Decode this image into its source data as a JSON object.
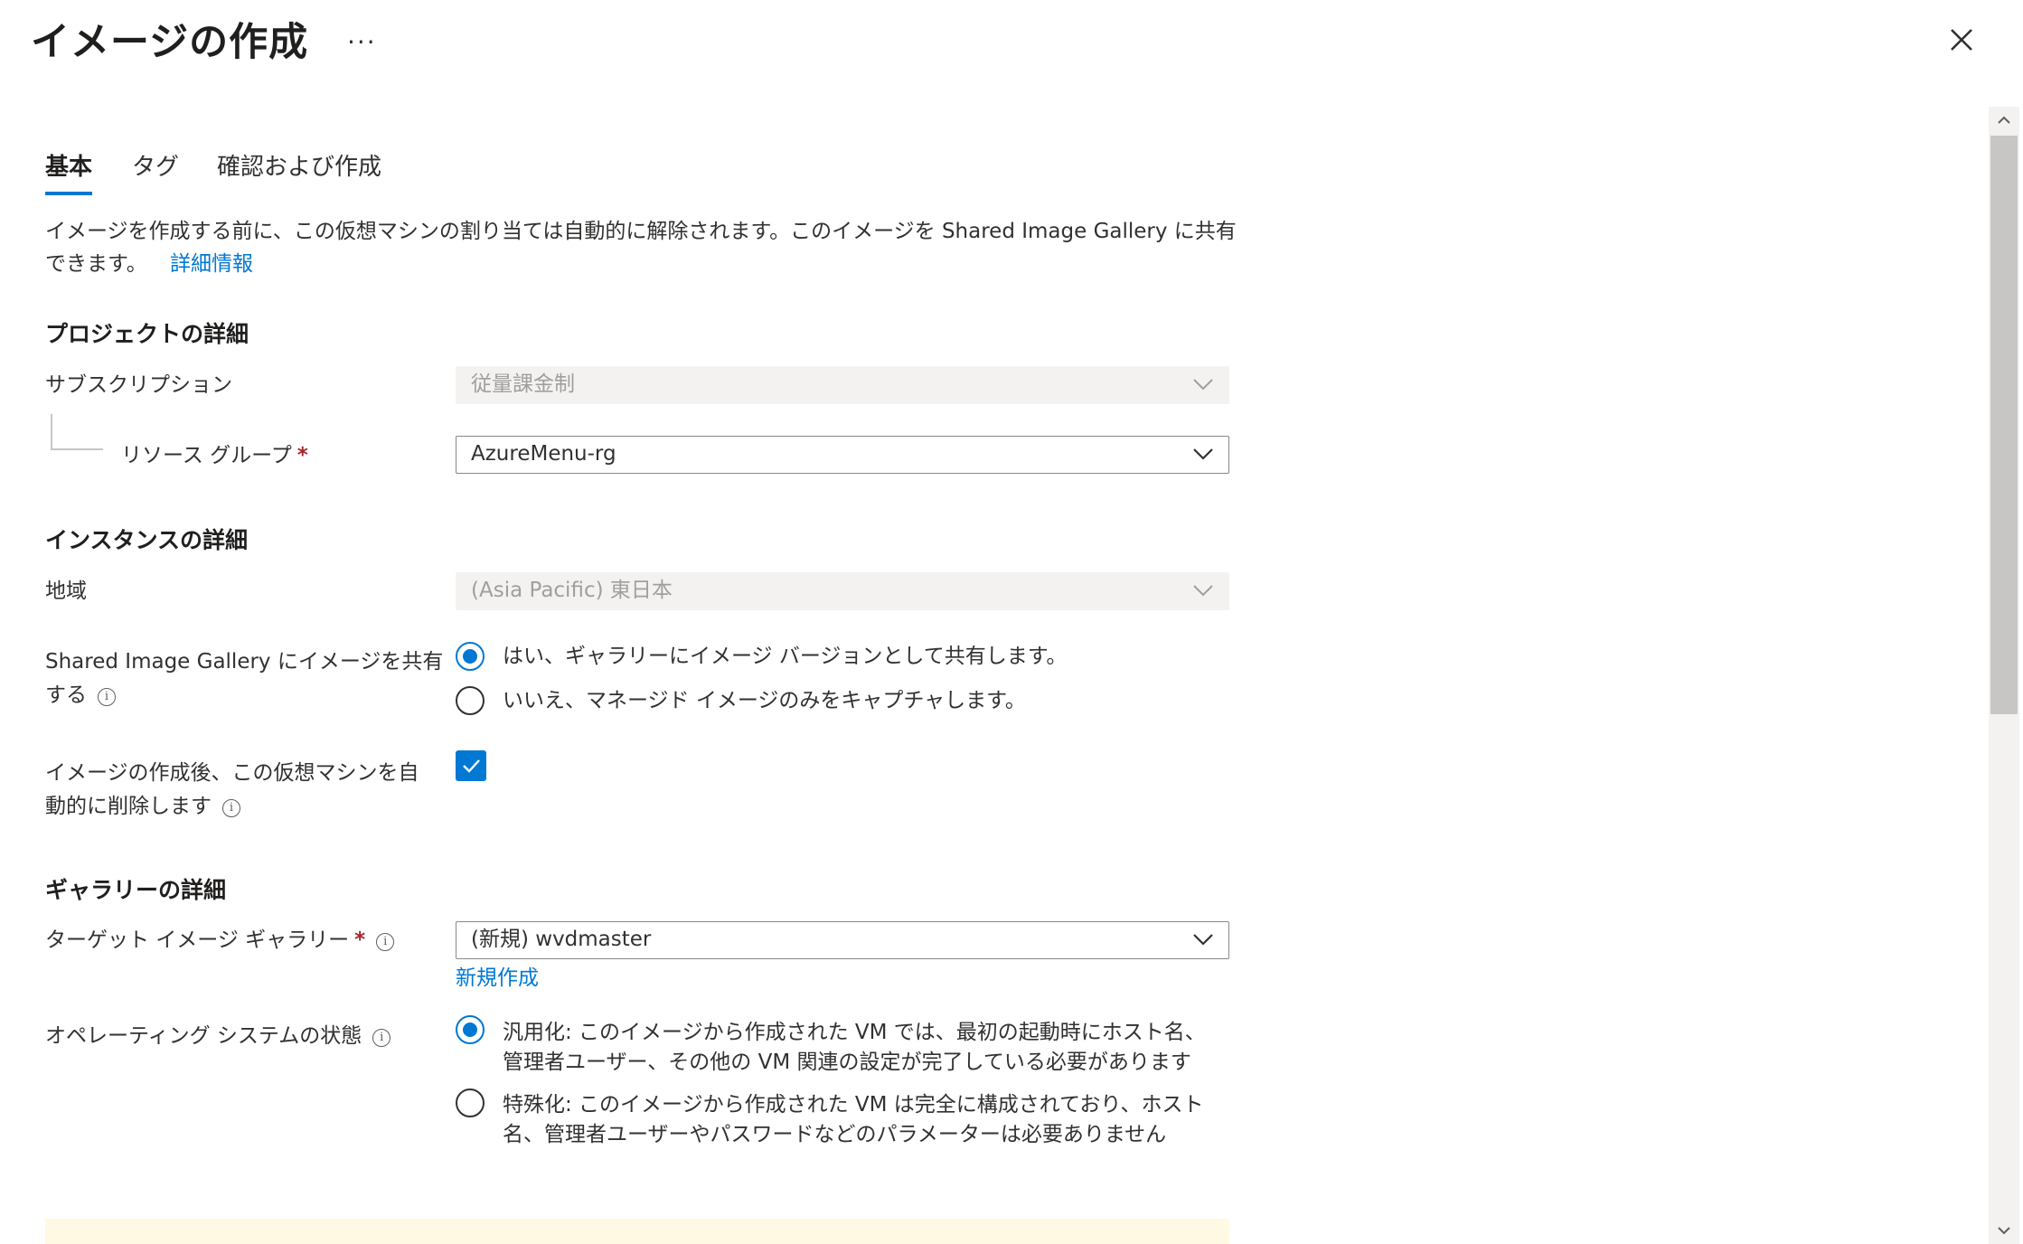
{
  "header": {
    "title": "イメージの作成",
    "more_label": "...",
    "close_icon": "close-icon"
  },
  "tabs": [
    {
      "label": "基本",
      "active": true
    },
    {
      "label": "タグ",
      "active": false
    },
    {
      "label": "確認および作成",
      "active": false
    }
  ],
  "description": {
    "text": "イメージを作成する前に、この仮想マシンの割り当ては自動的に解除されます。このイメージを Shared Image Gallery に共有できます。",
    "link": "詳細情報"
  },
  "project": {
    "heading": "プロジェクトの詳細",
    "subscription_label": "サブスクリプション",
    "subscription_value": "従量課金制",
    "resource_group_label": "リソース グループ",
    "resource_group_value": "AzureMenu-rg",
    "required_mark": "*"
  },
  "instance": {
    "heading": "インスタンスの詳細",
    "region_label": "地域",
    "region_value": "(Asia Pacific) 東日本",
    "share_label_line1": "Shared Image Gallery にイメージを共有",
    "share_label_line2": "する",
    "share_yes": "はい、ギャラリーにイメージ バージョンとして共有します。",
    "share_no": "いいえ、マネージド イメージのみをキャプチャします。",
    "autodelete_label_line1": "イメージの作成後、この仮想マシンを自",
    "autodelete_label_line2": "動的に削除します",
    "autodelete_checked": true
  },
  "gallery": {
    "heading": "ギャラリーの詳細",
    "target_label": "ターゲット イメージ ギャラリー",
    "target_value": "(新規) wvdmaster",
    "create_new": "新規作成",
    "os_state_label": "オペレーティング システムの状態",
    "generalized_line1": "汎用化: このイメージから作成された VM では、最初の起動時にホスト名、",
    "generalized_line2": "管理者ユーザー、その他の VM 関連の設定が完了している必要があります",
    "specialized_line1": "特殊化: このイメージから作成された VM は完全に構成されており、ホスト",
    "specialized_line2": "名、管理者ユーザーやパスワードなどのパラメーターは必要ありません"
  },
  "colors": {
    "accent": "#0078d4",
    "required": "#a4262c",
    "disabled_bg": "#f3f2f1"
  }
}
